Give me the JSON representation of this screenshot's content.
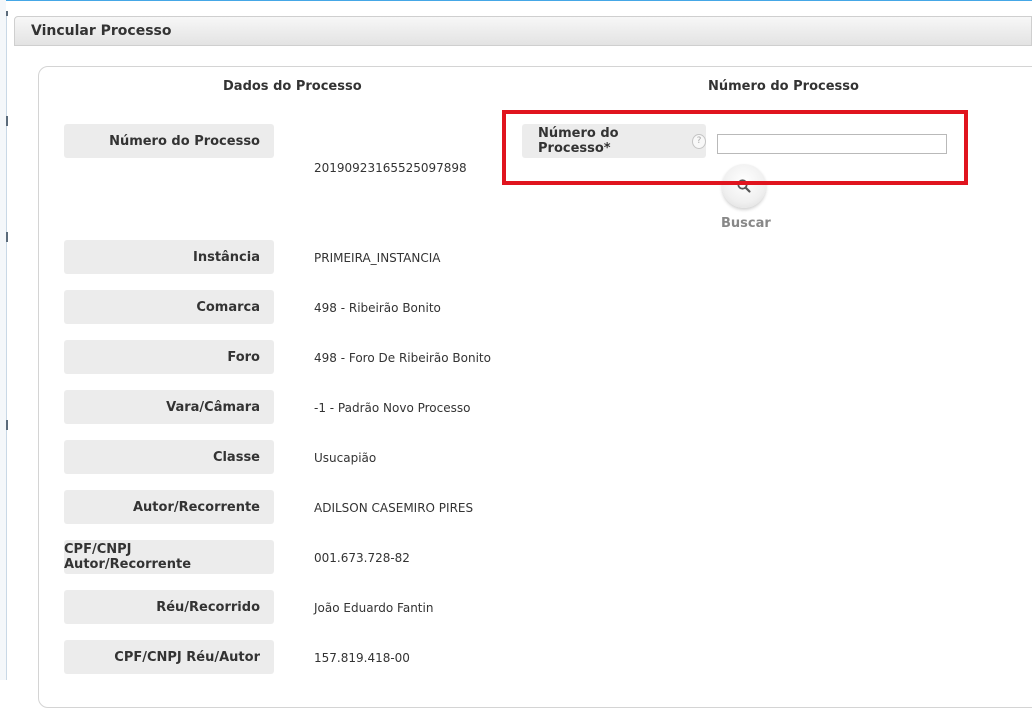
{
  "window": {
    "title": "Vincular Processo"
  },
  "sections": {
    "left_heading": "Dados do Processo",
    "right_heading": "Número do Processo"
  },
  "fields": [
    {
      "label": "Número do Processo",
      "value": "20190923165525097898"
    },
    {
      "label": "Instância",
      "value": "PRIMEIRA_INSTANCIA"
    },
    {
      "label": "Comarca",
      "value": "498 - Ribeirão Bonito"
    },
    {
      "label": "Foro",
      "value": "498 - Foro De Ribeirão Bonito"
    },
    {
      "label": "Vara/Câmara",
      "value": "-1 - Padrão Novo Processo"
    },
    {
      "label": "Classe",
      "value": "Usucapião"
    },
    {
      "label": "Autor/Recorrente",
      "value": "ADILSON CASEMIRO PIRES"
    },
    {
      "label": "CPF/CNPJ Autor/Recorrente",
      "value": "001.673.728-82"
    },
    {
      "label": "Réu/Recorrido",
      "value": "João Eduardo Fantin"
    },
    {
      "label": "CPF/CNPJ Réu/Autor",
      "value": "157.819.418-00"
    }
  ],
  "search": {
    "label": "Número do Processo*",
    "help_icon": "question-circle-icon",
    "help_symbol": "?",
    "input_value": "",
    "button_icon": "magnifier-icon",
    "button_caption": "Buscar"
  },
  "colors": {
    "highlight": "#e0141e",
    "label_bg": "#ececec"
  }
}
